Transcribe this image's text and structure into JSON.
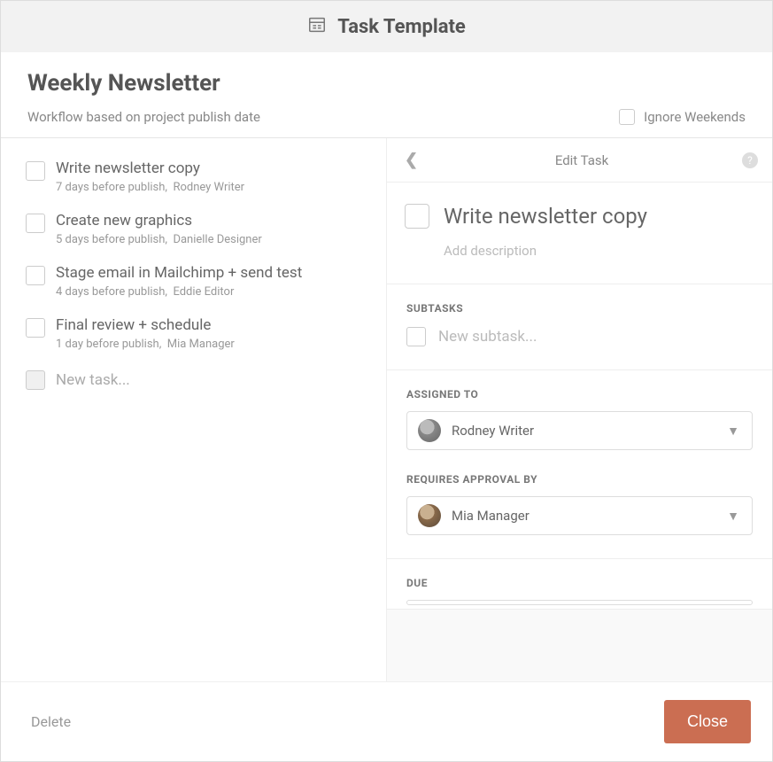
{
  "header": {
    "title": "Task Template"
  },
  "page": {
    "title": "Weekly Newsletter",
    "workflow_label": "Workflow based on project publish date",
    "ignore_weekends_label": "Ignore Weekends"
  },
  "tasks": [
    {
      "title": "Write newsletter copy",
      "timing": "7 days before publish,",
      "assignee": "Rodney Writer"
    },
    {
      "title": "Create new graphics",
      "timing": "5 days before publish,",
      "assignee": "Danielle Designer"
    },
    {
      "title": "Stage email in Mailchimp + send test",
      "timing": "4 days before publish,",
      "assignee": "Eddie Editor"
    },
    {
      "title": "Final review + schedule",
      "timing": "1 day before publish,",
      "assignee": "Mia Manager"
    }
  ],
  "new_task_placeholder": "New task...",
  "edit": {
    "header": "Edit Task",
    "task_title": "Write newsletter copy",
    "add_description_placeholder": "Add description",
    "subtasks_label": "SUBTASKS",
    "new_subtask_placeholder": "New subtask...",
    "assigned_to_label": "ASSIGNED TO",
    "assigned_to_value": "Rodney Writer",
    "requires_approval_label": "REQUIRES APPROVAL BY",
    "requires_approval_value": "Mia Manager",
    "due_label": "DUE"
  },
  "footer": {
    "delete": "Delete",
    "close": "Close"
  }
}
